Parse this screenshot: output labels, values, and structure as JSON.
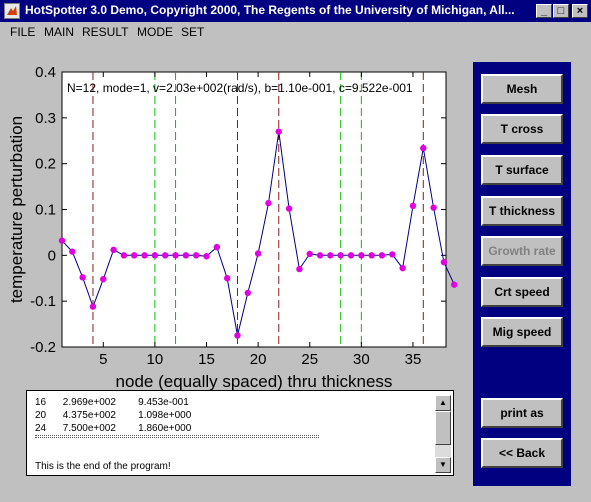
{
  "window": {
    "title": "HotSpotter 3.0 Demo,  Copyright 2000,  The Regents of the University of Michigan,  All..."
  },
  "menu": [
    "FILE",
    "MAIN",
    "RESULT",
    "MODE",
    "SET"
  ],
  "chart_data": {
    "type": "line",
    "annotation": "N=12, mode=1, v=2.03e+002(rad/s), b=1.10e-001, c=9.522e-001",
    "xlabel": "node (equally spaced) thru thickness",
    "ylabel": "temperature perturbation",
    "xlim": [
      1,
      38.2
    ],
    "ylim": [
      -0.2,
      0.4
    ],
    "xticks": [
      5,
      10,
      15,
      20,
      25,
      30,
      35
    ],
    "yticks": [
      -0.2,
      -0.1,
      0,
      0.1,
      0.2,
      0.3,
      0.4
    ],
    "ytick_labels": [
      "-0.2",
      "-0.1",
      "0",
      "0.1",
      "0.2",
      "0.3",
      "0.4"
    ],
    "grid": false,
    "brown_dashed_lines_x": [
      4,
      18,
      22,
      36
    ],
    "green_dashed_lines_x": [
      10,
      12,
      28,
      30
    ],
    "series": [
      {
        "color": "#000080",
        "marker_color": "#e000e0",
        "x": [
          1,
          2,
          3,
          4,
          5,
          6,
          7,
          8,
          9,
          10,
          11,
          12,
          13,
          14,
          15,
          16,
          17,
          18,
          19,
          20,
          21,
          22,
          23,
          24,
          25,
          26,
          27,
          28,
          29,
          30,
          31,
          32,
          33,
          34,
          35,
          36,
          37,
          38,
          39
        ],
        "values": [
          0.032,
          0.008,
          -0.048,
          -0.112,
          -0.052,
          0.012,
          0.0,
          0.0,
          0.0,
          0.0,
          0.0,
          0.0,
          0.0,
          0.0,
          -0.002,
          0.018,
          -0.05,
          -0.175,
          -0.082,
          0.004,
          0.114,
          0.27,
          0.102,
          -0.03,
          0.003,
          0.0,
          0.0,
          0.0,
          0.0,
          0.0,
          0.0,
          0.0,
          0.002,
          -0.028,
          0.108,
          0.234,
          0.104,
          -0.015,
          -0.064
        ]
      }
    ]
  },
  "buttons": {
    "mesh": "Mesh",
    "t_cross": "T cross",
    "t_surface": "T surface",
    "t_thickness": "T thickness",
    "growth_rate": "Growth rate",
    "crt_speed": "Crt speed",
    "mig_speed": "Mig speed",
    "print_as": "print as",
    "back": "<< Back"
  },
  "output": {
    "rows": [
      {
        "n": "16",
        "a": "2.969e+002",
        "b": "9.453e-001"
      },
      {
        "n": "20",
        "a": "4.375e+002",
        "b": "1.098e+000"
      },
      {
        "n": "24",
        "a": "7.500e+002",
        "b": "1.860e+000"
      }
    ],
    "message": "This is the end of the program!"
  }
}
